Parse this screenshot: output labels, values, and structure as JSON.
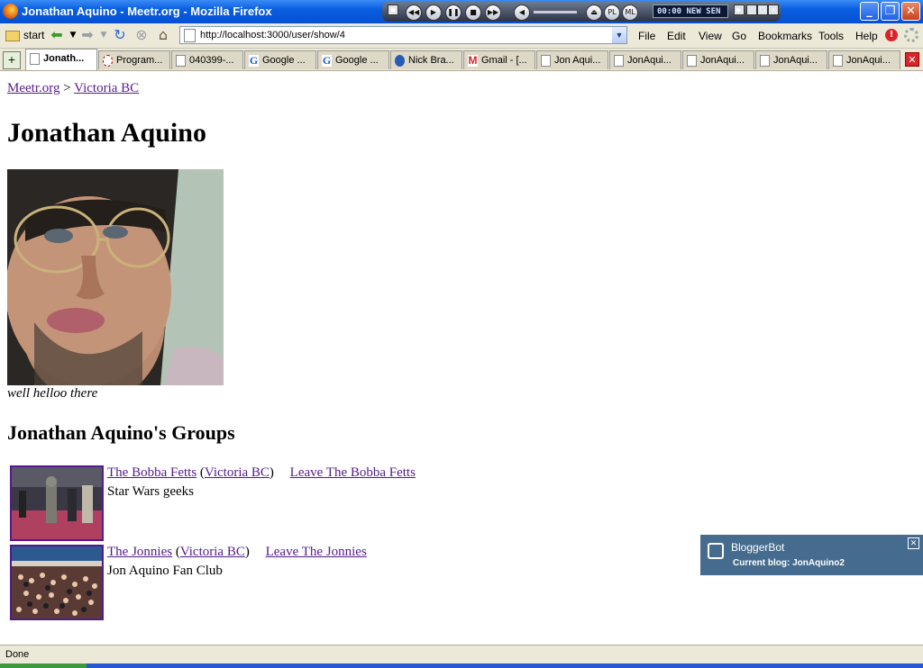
{
  "window": {
    "title": "Jonathan Aquino - Meetr.org - Mozilla Firefox"
  },
  "media_player": {
    "display": "00:00   NEW SEN",
    "btn_pl": "PL",
    "btn_ml": "ML"
  },
  "toolbar": {
    "start_label": "start",
    "url": "http://localhost:3000/user/show/4",
    "menu": [
      "File",
      "Edit",
      "View",
      "Go",
      "Bookmarks",
      "Tools",
      "Help"
    ]
  },
  "tabs": [
    {
      "label": "Jonath...",
      "icon": "page"
    },
    {
      "label": "Program...",
      "icon": "loading"
    },
    {
      "label": "040399-...",
      "icon": "page"
    },
    {
      "label": "Google ...",
      "icon": "google"
    },
    {
      "label": "Google ...",
      "icon": "google"
    },
    {
      "label": "Nick Bra...",
      "icon": "globe"
    },
    {
      "label": "Gmail - [...",
      "icon": "gmail"
    },
    {
      "label": "Jon Aqui...",
      "icon": "page"
    },
    {
      "label": "JonAqui...",
      "icon": "page"
    },
    {
      "label": "JonAqui...",
      "icon": "page"
    },
    {
      "label": "JonAqui...",
      "icon": "page"
    },
    {
      "label": "JonAqui...",
      "icon": "page"
    }
  ],
  "page": {
    "breadcrumb": {
      "home": "Meetr.org",
      "sep": " > ",
      "city": "Victoria BC"
    },
    "heading": "Jonathan Aquino",
    "photo_caption": "well helloo there",
    "groups_heading": "Jonathan Aquino's Groups",
    "groups": [
      {
        "name": "The Bobba Fetts",
        "location": "Victoria BC",
        "leave": "Leave The Bobba Fetts",
        "description": "Star Wars geeks"
      },
      {
        "name": "The Jonnies",
        "location": "Victoria BC",
        "leave": "Leave The Jonnies",
        "description": "Jon Aquino Fan Club"
      }
    ]
  },
  "bloggerbot": {
    "title": "BloggerBot",
    "subtitle": "Current blog: JonAquino2"
  },
  "status": {
    "text": "Done"
  }
}
